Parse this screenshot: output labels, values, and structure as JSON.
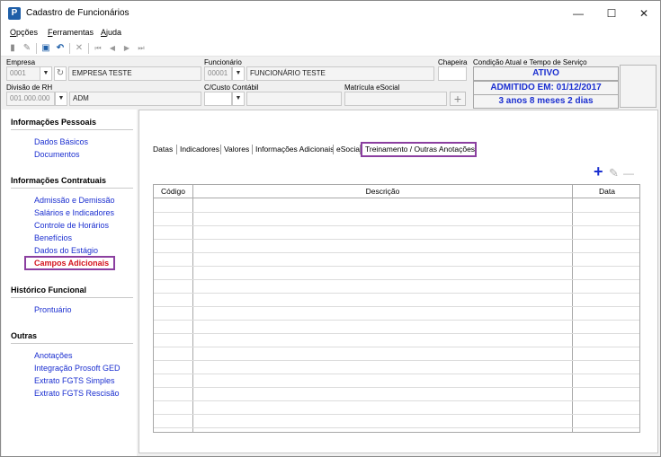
{
  "window": {
    "title": "Cadastro de Funcionários",
    "app_icon": "P",
    "controls": {
      "minimize": "—",
      "maximize": "☐",
      "close": "✕"
    }
  },
  "menu": {
    "items": [
      {
        "pre": "",
        "u": "O",
        "post": "pções"
      },
      {
        "pre": "",
        "u": "F",
        "post": "erramentas"
      },
      {
        "pre": "",
        "u": "A",
        "post": "juda"
      }
    ]
  },
  "toolbar": {
    "icons": [
      "new-document-icon",
      "edit-pencil-icon",
      "save-disk-icon",
      "undo-icon",
      "delete-x-icon",
      "first-record-icon",
      "previous-record-icon",
      "next-record-icon",
      "last-record-icon"
    ],
    "glyphs": {
      "new": "▮",
      "edit": "✎",
      "save": "▣",
      "undo": "↶",
      "delete": "✕",
      "first": "⏮",
      "prev": "◀",
      "next": "▶",
      "last": "⏭"
    }
  },
  "header": {
    "empresa_label": "Empresa",
    "empresa_code": "0001",
    "empresa_name": "EMPRESA TESTE",
    "funcionario_label": "Funcionário",
    "funcionario_code": "00001",
    "funcionario_name": "FUNCIONÁRIO TESTE",
    "chapeira_label": "Chapeira",
    "chapeira_value": "",
    "divisao_label": "Divisão de RH",
    "divisao_code": "001.000.000",
    "divisao_name": "ADM",
    "custo_label": "C/Custo Contábil",
    "custo_code": "",
    "custo_name": "",
    "matricula_label": "Matrícula eSocial",
    "matricula_value": "",
    "condicao_label": "Condição Atual e Tempo de Serviço",
    "status": "ATIVO",
    "admitido": "ADMITIDO EM: 01/12/2017",
    "tempo": "3 anos 8 meses 2 dias",
    "plus_glyph": "+",
    "dropdown_glyph": "▼",
    "refresh_glyph": "↻"
  },
  "sidebar": {
    "sections": {
      "pessoais": "Informações Pessoais",
      "contratuais": "Informações Contratuais",
      "historico": "Histórico Funcional",
      "outras": "Outras"
    },
    "links": {
      "dados_basicos": "Dados Básicos",
      "documentos": "Documentos",
      "admissao": "Admissão e Demissão",
      "salarios": "Salários e Indicadores",
      "horarios": "Controle de Horários",
      "beneficios": "Benefícios",
      "estagio": "Dados do Estágio",
      "campos_adicionais": "Campos Adicionais",
      "prontuario": "Prontuário",
      "anotacoes": "Anotações",
      "integracao": "Integração Prosoft GED",
      "fgts_simples": "Extrato FGTS Simples",
      "fgts_rescisao": "Extrato FGTS Rescisão"
    }
  },
  "tabs": {
    "datas": "Datas",
    "indicadores": "Indicadores",
    "valores": "Valores",
    "info_adicionais": "Informações Adicionais",
    "esocial": "eSocial",
    "treinamento": "Treinamento / Outras Anotações"
  },
  "actions": {
    "add": "+",
    "edit": "✎",
    "remove": "—"
  },
  "grid": {
    "columns": {
      "codigo": "Código",
      "descricao": "Descrição",
      "data": "Data"
    },
    "rows": []
  },
  "colors": {
    "accent_purple": "#8b3fa0",
    "link_blue": "#1b2fd0",
    "active_red": "#d4141e"
  }
}
